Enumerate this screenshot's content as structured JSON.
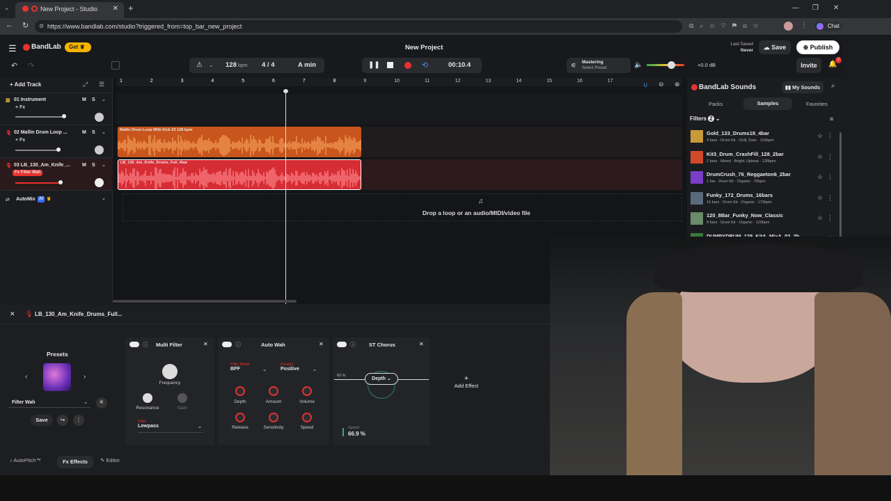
{
  "browser": {
    "tab_title": "New Project - Studio",
    "url": "https://www.bandlab.com/studio?triggered_from=top_bar_new_project",
    "chat_label": "Chat"
  },
  "app": {
    "brand": "BandLab",
    "get_label": "Get",
    "project_title": "New Project",
    "bpm_value": "128",
    "bpm_unit": "bpm",
    "time_signature": "4 / 4",
    "key": "A min",
    "time_display": "00:10.4",
    "mastering_label": "Mastering",
    "mastering_preset": "Select Preset",
    "volume_db": "+0.0 dB",
    "last_saved_label": "Last Saved",
    "last_saved_value": "Never",
    "save_label": "Save",
    "publish_label": "Publish",
    "invite_label": "Invite",
    "notification_count": "2",
    "accent": "#e8322f"
  },
  "toolbar": {
    "add_track_label": "Add Track"
  },
  "tracks": [
    {
      "name": "01 Instrument",
      "fx": "+ Fx",
      "m": "M",
      "s": "S"
    },
    {
      "name": "02 Mallin Drum Loop ...",
      "fx": "+ Fx",
      "m": "M",
      "s": "S"
    },
    {
      "name": "03 LB_130_Am_Knife_...",
      "fx": "Fx Filter Wah",
      "m": "M",
      "s": "S"
    }
  ],
  "automix": {
    "label": "AutoMix",
    "ai": "AI"
  },
  "ruler": [
    "1",
    "2",
    "3",
    "4",
    "5",
    "6",
    "7",
    "8",
    "9",
    "10",
    "11",
    "12",
    "13",
    "14",
    "15",
    "16",
    "17"
  ],
  "clips": {
    "clip2": "Mallin Drum Loop With Kick 03 128 bpm",
    "clip3": "LB_130_Am_Knife_Drums_Full_4bar"
  },
  "drop_text": "Drop a loop or an audio/MIDI/video file",
  "sounds": {
    "title": "BandLab Sounds",
    "my_sounds": "My Sounds",
    "tabs": [
      "Packs",
      "Samples",
      "Favorites"
    ],
    "filters_label": "Filters",
    "filters_count": "2",
    "items": [
      {
        "name": "Gold_133_Drums19_4bar",
        "meta": "4 bars · Drum Kit · Chill, Dark · 133bpm"
      },
      {
        "name": "Kit3_Drum_CrashFill_128_2bar",
        "meta": "2 bars · Mixed · Bright, Upbeat · 128bpm"
      },
      {
        "name": "DrumCrush_76_Reggaeton6_2bar",
        "meta": "1 bar · Drum Kit · Organic · 76bpm"
      },
      {
        "name": "Funky_172_Drums_16bars",
        "meta": "16 bars · Drum Kit · Organic · 172bpm"
      },
      {
        "name": "120_8Bar_Funky_Now_Classic",
        "meta": "8 bars · Drum Kit · Organic · 120bpm"
      },
      {
        "name": "DUMPYDRUM_128_KitA_MixA_02_2b...",
        "meta": ""
      }
    ]
  },
  "fxpanel": {
    "track_name": "LB_130_Am_Knife_Drums_Full...",
    "presets_title": "Presets",
    "preset_select": "Filter Wah",
    "save_label": "Save",
    "multi_filter": {
      "title": "Multi Filter",
      "frequency": "Frequency",
      "resonance": "Resonance",
      "gain": "Gain",
      "filter_label": "Filter",
      "filter_value": "Lowpass"
    },
    "auto_wah": {
      "title": "Auto Wah",
      "filter_mode_label": "Filter Mode",
      "filter_mode_value": "BPF",
      "polarity_label": "Polarity",
      "polarity_value": "Positive",
      "depth": "Depth",
      "amount": "Amount",
      "volume": "Volume",
      "release": "Release",
      "sensitivity": "Sensitivity",
      "speed": "Speed"
    },
    "st_chorus": {
      "title": "ST Chorus",
      "pct": "60 %",
      "param": "Depth",
      "speed_label": "Speed",
      "speed_value": "66.9 %"
    },
    "add_effect": "Add Effect"
  },
  "bottom_tabs": [
    "AutoPitch™",
    "Effects",
    "Editor"
  ]
}
